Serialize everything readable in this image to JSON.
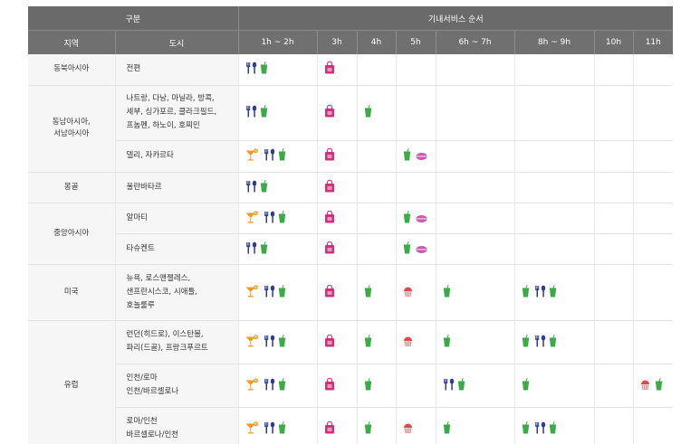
{
  "header": {
    "group_label": "구분",
    "service_label": "기내서비스 순서",
    "col_region": "지역",
    "col_city": "도시",
    "hours": [
      "1h ~ 2h",
      "3h",
      "4h",
      "5h",
      "6h ~ 7h",
      "8h ~ 9h",
      "10h",
      "11h"
    ]
  },
  "regions": [
    "동북아시아",
    "동남아시아,\n서남아시아",
    "몽골",
    "중앙아시아",
    "미국",
    "유럽"
  ],
  "cities": [
    "전편",
    "나트랑, 다낭, 마닐라, 방콕,\n세부, 싱가포르, 클라크필드,\n프놈펜, 하노이, 호찌민",
    "델리, 자카르타",
    "울란바타르",
    "알마티",
    "타슈켄트",
    "뉴욕, 로스앤젤레스,\n샌프란시스코, 시애틀,\n호놀룰루",
    "런던(히드로), 이스탄불,\n파리(드골), 프랑크푸르트",
    "인천/로마\n인천/바르셀로나",
    "로마/인천\n바르셀로나/인천"
  ],
  "rows": [
    {
      "hours": [
        [
          "meal",
          "drink"
        ],
        [
          "shop"
        ],
        [],
        [],
        [],
        [],
        [],
        []
      ]
    },
    {
      "hours": [
        [
          "meal",
          "drink"
        ],
        [
          "shop"
        ],
        [
          "drink"
        ],
        [],
        [],
        [],
        [],
        []
      ]
    },
    {
      "hours": [
        [
          "cocktail",
          "meal",
          "drink"
        ],
        [
          "shop"
        ],
        [],
        [
          "drink",
          "snack"
        ],
        [],
        [],
        [],
        []
      ]
    },
    {
      "hours": [
        [
          "meal",
          "drink"
        ],
        [
          "shop"
        ],
        [],
        [],
        [],
        [],
        [],
        []
      ]
    },
    {
      "hours": [
        [
          "cocktail",
          "meal",
          "drink"
        ],
        [
          "shop"
        ],
        [],
        [
          "drink",
          "snack"
        ],
        [],
        [],
        [],
        []
      ]
    },
    {
      "hours": [
        [
          "meal",
          "drink"
        ],
        [
          "shop"
        ],
        [],
        [
          "drink",
          "snack"
        ],
        [],
        [],
        [],
        []
      ]
    },
    {
      "hours": [
        [
          "cocktail",
          "meal",
          "drink"
        ],
        [
          "shop"
        ],
        [
          "drink"
        ],
        [
          "cake"
        ],
        [
          "drink"
        ],
        [
          "drink",
          "meal",
          "drink"
        ],
        [],
        []
      ]
    },
    {
      "hours": [
        [
          "cocktail",
          "meal",
          "drink"
        ],
        [
          "shop"
        ],
        [
          "drink"
        ],
        [
          "cake"
        ],
        [
          "drink"
        ],
        [
          "drink",
          "meal",
          "drink"
        ],
        [],
        []
      ]
    },
    {
      "hours": [
        [
          "cocktail",
          "meal",
          "drink"
        ],
        [
          "shop"
        ],
        [
          "drink"
        ],
        [],
        [
          "meal",
          "drink"
        ],
        [
          "drink"
        ],
        [],
        [
          "cake",
          "drink"
        ]
      ]
    },
    {
      "hours": [
        [
          "cocktail",
          "meal",
          "drink"
        ],
        [
          "shop"
        ],
        [
          "drink"
        ],
        [
          "cake"
        ],
        [
          "drink"
        ],
        [
          "drink",
          "meal",
          "drink"
        ],
        [],
        []
      ]
    }
  ],
  "icon_names": {
    "meal": "fork-spoon-icon",
    "drink": "drink-cup-icon",
    "shop": "duty-free-bag-icon",
    "cocktail": "cocktail-icon",
    "snack": "snack-icon",
    "cake": "cupcake-icon"
  },
  "colors": {
    "header_bg": "#6a6a6a",
    "meal": "#2f3e8c",
    "drink": "#3daa4a",
    "shop": "#d0317a",
    "cocktail": "#f39a1e",
    "snack": "#c85bb0",
    "cake": "#e14a4a"
  }
}
